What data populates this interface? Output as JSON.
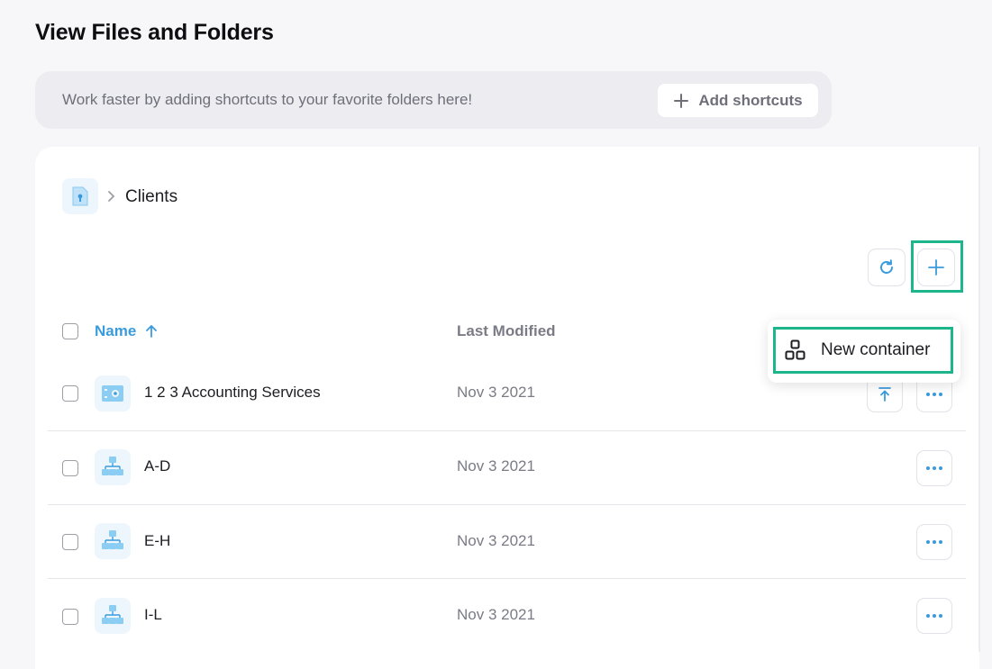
{
  "page": {
    "title": "View Files and Folders"
  },
  "shortcuts": {
    "text": "Work faster by adding shortcuts to your favorite folders here!",
    "add_label": "Add shortcuts"
  },
  "breadcrumb": {
    "home_icon": "folder-lock-icon",
    "current": "Clients"
  },
  "toolbar": {
    "refresh_icon": "refresh-icon",
    "add_icon": "plus-icon"
  },
  "table": {
    "columns": {
      "name": "Name",
      "modified": "Last Modified"
    },
    "sort": "ascending",
    "rows": [
      {
        "name": "1 2 3 Accounting Services",
        "modified": "Nov 3 2021",
        "icon": "safe-icon"
      },
      {
        "name": "A-D",
        "modified": "Nov 3 2021",
        "icon": "container-icon"
      },
      {
        "name": "E-H",
        "modified": "Nov 3 2021",
        "icon": "container-icon"
      },
      {
        "name": "I-L",
        "modified": "Nov 3 2021",
        "icon": "container-icon"
      }
    ]
  },
  "menu": {
    "new_container": "New container",
    "icon": "container-grid-icon"
  },
  "colors": {
    "accent": "#3a9bdc",
    "highlight": "#1db58c",
    "icon_bg": "#eef6fd"
  }
}
